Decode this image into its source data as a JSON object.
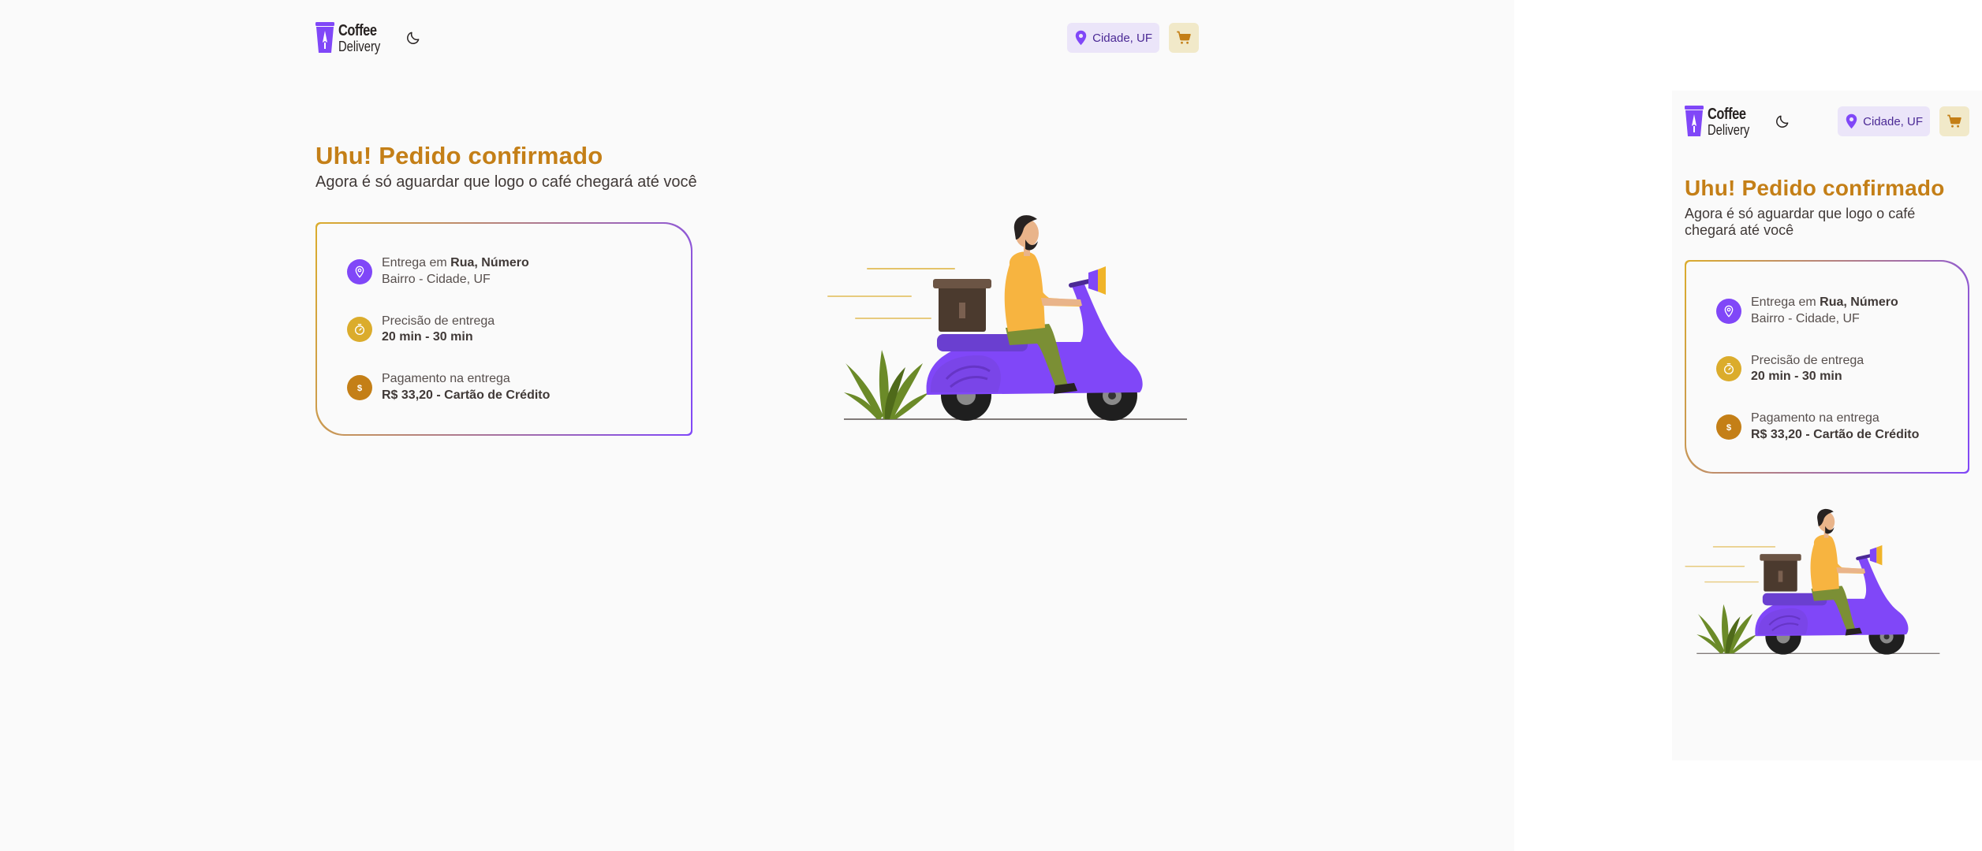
{
  "header": {
    "logo_title": "Coffee",
    "logo_subtitle": "Delivery",
    "location_label": "Cidade, UF",
    "logo_icon": "coffee-cup-logo",
    "theme_icon": "moon-icon",
    "location_icon": "map-pin-icon",
    "cart_icon": "shopping-cart-icon"
  },
  "confirmation": {
    "title": "Uhu! Pedido confirmado",
    "subtitle": "Agora é só aguardar que logo o café chegará até você"
  },
  "order_info": {
    "delivery": {
      "prefix": "Entrega em ",
      "address": "Rua, Número",
      "district": "Bairro - Cidade, UF",
      "icon": "map-pin-icon"
    },
    "time": {
      "label": "Precisão de entrega",
      "value": "20 min - 30 min",
      "icon": "timer-icon"
    },
    "payment": {
      "label": "Pagamento na entrega",
      "value": "R$ 33,20 - Cartão de Crédito",
      "icon": "currency-dollar-icon"
    }
  },
  "colors": {
    "brand_yellow_dark": "#c47f17",
    "brand_yellow": "#dbac2c",
    "brand_yellow_light": "#f1e9c9",
    "brand_purple": "#8047f8",
    "brand_purple_dark": "#4b2995",
    "brand_purple_light": "#ebe5f9",
    "background": "#fafafa"
  },
  "illustration": {
    "icon": "delivery-scooter-illustration"
  }
}
